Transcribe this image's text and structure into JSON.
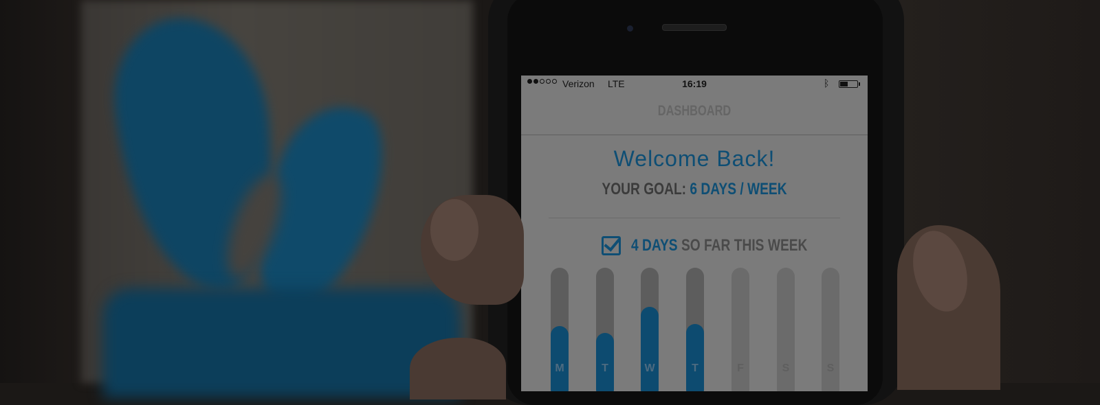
{
  "status_bar": {
    "signal_dots_filled": 2,
    "signal_dots_total": 5,
    "carrier": "Verizon",
    "network": "LTE",
    "time": "16:19",
    "bluetooth_icon": "bluetooth-icon",
    "battery_level": 0.45
  },
  "nav": {
    "title": "DASHBOARD"
  },
  "dashboard": {
    "welcome": "Welcome Back!",
    "goal_label": "YOUR GOAL:",
    "goal_value": "6 DAYS / WEEK",
    "progress_count": "4 DAYS",
    "progress_rest": "SO FAR THIS WEEK",
    "check_icon": "checkbox-checked-icon"
  },
  "colors": {
    "accent": "#1a9ae0",
    "text_gray": "#7a7a7a",
    "screen_bg": "#f5f5f5"
  },
  "chart_data": {
    "type": "bar",
    "categories": [
      "M",
      "T",
      "W",
      "T",
      "F",
      "S",
      "S"
    ],
    "values": [
      0.55,
      0.5,
      0.7,
      0.57,
      0,
      0,
      0
    ],
    "active": [
      true,
      true,
      true,
      true,
      false,
      false,
      false
    ]
  }
}
